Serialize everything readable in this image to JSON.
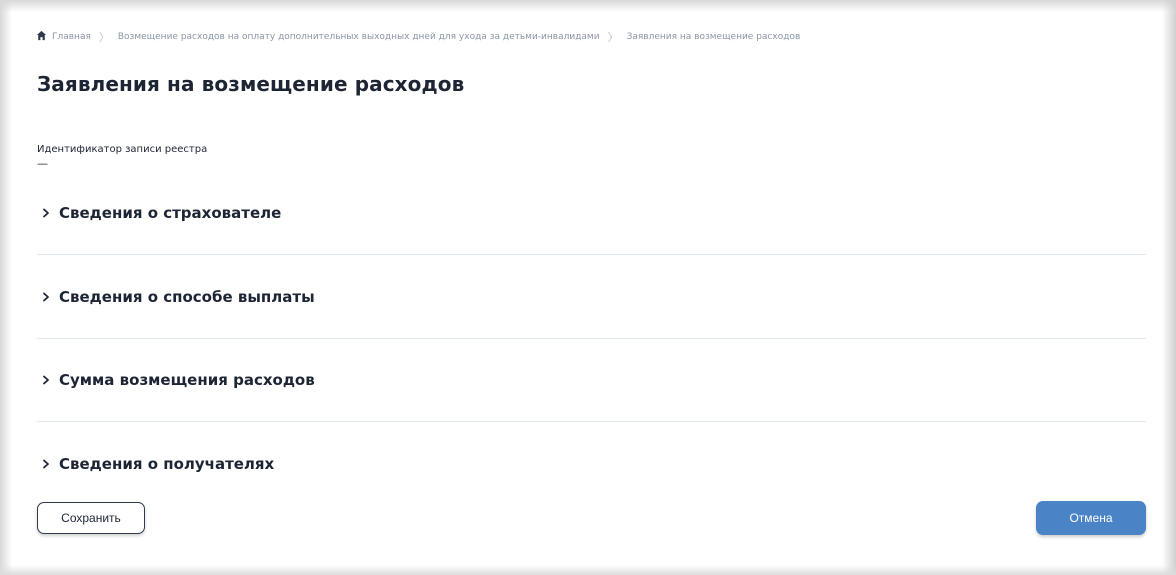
{
  "breadcrumb": {
    "items": [
      "Главная",
      "Возмещение расходов на оплату дополнительных выходных дней для ухода за детьми-инвалидами",
      "Заявления на возмещение расходов"
    ]
  },
  "page": {
    "title": "Заявления на возмещение расходов"
  },
  "registry": {
    "label": "Идентификатор записи реестра",
    "value": "—"
  },
  "sections": [
    {
      "label": "Сведения о страхователе"
    },
    {
      "label": "Сведения о способе выплаты"
    },
    {
      "label": "Сумма возмещения расходов"
    },
    {
      "label": "Сведения о получателях"
    }
  ],
  "actions": {
    "save_label": "Сохранить",
    "cancel_label": "Отмена"
  },
  "colors": {
    "primary": "#4a84c6",
    "text": "#1d2433",
    "muted": "#8a95a5",
    "divider": "#dfe8f3"
  },
  "icons": {
    "home": "home-icon",
    "separator": "chevron-right-icon",
    "section_toggle": "chevron-right-icon"
  }
}
